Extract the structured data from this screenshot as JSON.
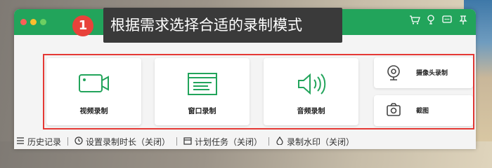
{
  "callout": {
    "badge": "1",
    "text": "根据需求选择合适的录制模式"
  },
  "titlebar": {
    "icons": [
      "cart-icon",
      "hint-icon",
      "message-icon",
      "pin-icon"
    ]
  },
  "modes": {
    "video": {
      "label": "视频录制",
      "icon": "video-camera-icon"
    },
    "window": {
      "label": "窗口录制",
      "icon": "window-icon"
    },
    "audio": {
      "label": "音频录制",
      "icon": "speaker-icon"
    },
    "webcam": {
      "label": "摄像头录制",
      "icon": "webcam-icon"
    },
    "screenshot": {
      "label": "截图",
      "icon": "camera-icon"
    }
  },
  "bottombar": {
    "history": "历史记录",
    "duration": "设置录制时长（关闭）",
    "schedule": "计划任务（关闭）",
    "watermark": "录制水印（关闭）"
  },
  "colors": {
    "accent": "#22a45b",
    "highlight_border": "#e53935",
    "badge": "#e8423a"
  }
}
